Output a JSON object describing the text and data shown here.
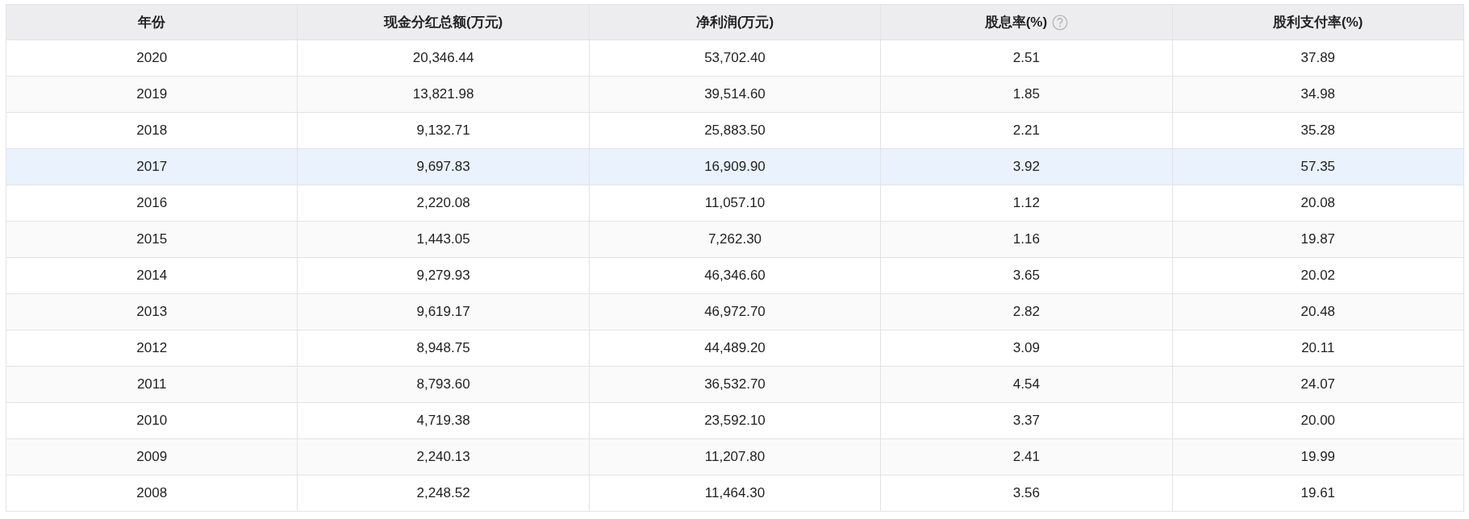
{
  "table": {
    "columns": [
      {
        "label": "年份",
        "help_icon": false
      },
      {
        "label": "现金分红总额(万元)",
        "help_icon": false
      },
      {
        "label": "净利润(万元)",
        "help_icon": false
      },
      {
        "label": "股息率(%)",
        "help_icon": true
      },
      {
        "label": "股利支付率(%)",
        "help_icon": false
      }
    ],
    "rows": [
      {
        "selected": false,
        "cells": [
          "2020",
          "20,346.44",
          "53,702.40",
          "2.51",
          "37.89"
        ]
      },
      {
        "selected": false,
        "cells": [
          "2019",
          "13,821.98",
          "39,514.60",
          "1.85",
          "34.98"
        ]
      },
      {
        "selected": false,
        "cells": [
          "2018",
          "9,132.71",
          "25,883.50",
          "2.21",
          "35.28"
        ]
      },
      {
        "selected": true,
        "cells": [
          "2017",
          "9,697.83",
          "16,909.90",
          "3.92",
          "57.35"
        ]
      },
      {
        "selected": false,
        "cells": [
          "2016",
          "2,220.08",
          "11,057.10",
          "1.12",
          "20.08"
        ]
      },
      {
        "selected": false,
        "cells": [
          "2015",
          "1,443.05",
          "7,262.30",
          "1.16",
          "19.87"
        ]
      },
      {
        "selected": false,
        "cells": [
          "2014",
          "9,279.93",
          "46,346.60",
          "3.65",
          "20.02"
        ]
      },
      {
        "selected": false,
        "cells": [
          "2013",
          "9,619.17",
          "46,972.70",
          "2.82",
          "20.48"
        ]
      },
      {
        "selected": false,
        "cells": [
          "2012",
          "8,948.75",
          "44,489.20",
          "3.09",
          "20.11"
        ]
      },
      {
        "selected": false,
        "cells": [
          "2011",
          "8,793.60",
          "36,532.70",
          "4.54",
          "24.07"
        ]
      },
      {
        "selected": false,
        "cells": [
          "2010",
          "4,719.38",
          "23,592.10",
          "3.37",
          "20.00"
        ]
      },
      {
        "selected": false,
        "cells": [
          "2009",
          "2,240.13",
          "11,207.80",
          "2.41",
          "19.99"
        ]
      },
      {
        "selected": false,
        "cells": [
          "2008",
          "2,248.52",
          "11,464.30",
          "3.56",
          "19.61"
        ]
      }
    ]
  }
}
